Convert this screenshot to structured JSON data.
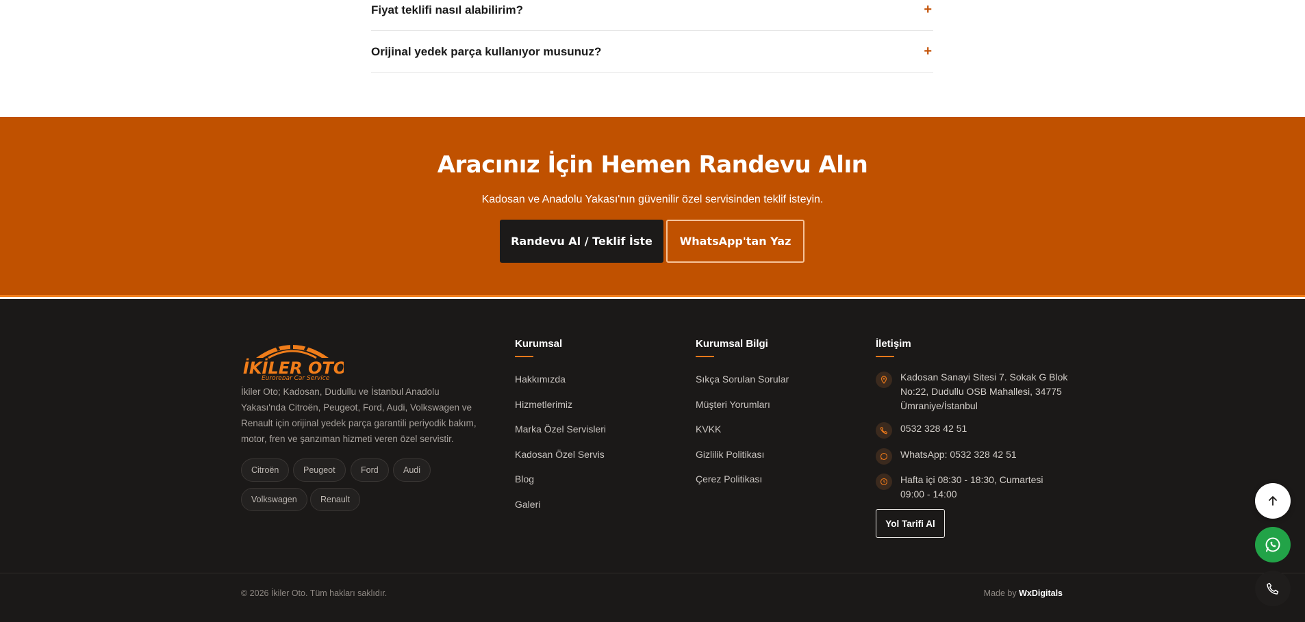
{
  "faq": {
    "items": [
      {
        "question": "Fiyat teklifi nasıl alabilirim?",
        "icon": "+"
      },
      {
        "question": "Orijinal yedek parça kullanıyor musunuz?",
        "icon": "+"
      }
    ]
  },
  "cta": {
    "title": "Aracınız İçin Hemen Randevu Alın",
    "subtitle": "Kadosan ve Anadolu Yakası'nın güvenilir özel servisinden teklif isteyin.",
    "primary_button": "Randevu Al / Teklif İste",
    "secondary_button": "WhatsApp'tan Yaz",
    "background_color": "#c05100"
  },
  "footer": {
    "logo": {
      "name": "İKİLER OTO",
      "tagline": "Eurorepar Car Service"
    },
    "about": "İkiler Oto; Kadosan, Dudullu ve İstanbul Anadolu Yakası'nda Citroën, Peugeot, Ford, Audi, Volkswagen ve Renault için orijinal yedek parça garantili periyodik bakım, motor, fren ve şanzıman hizmeti veren özel servistir.",
    "brands": [
      "Citroën",
      "Peugeot",
      "Ford",
      "Audi",
      "Volkswagen",
      "Renault"
    ],
    "columns": [
      {
        "title": "Kurumsal",
        "links": [
          "Hakkımızda",
          "Hizmetlerimiz",
          "Marka Özel Servisleri",
          "Kadosan Özel Servis",
          "Blog",
          "Galeri"
        ]
      },
      {
        "title": "Kurumsal Bilgi",
        "links": [
          "Sıkça Sorulan Sorular",
          "Müşteri Yorumları",
          "KVKK",
          "Gizlilik Politikası",
          "Çerez Politikası"
        ]
      }
    ],
    "contact": {
      "title": "İletişim",
      "address": "Kadosan Sanayi Sitesi 7. Sokak G Blok No:22, Dudullu OSB Mahallesi, 34775 Ümraniye/İstanbul",
      "phone": "0532 328 42 51",
      "whatsapp": "WhatsApp: 0532 328 42 51",
      "hours": "Hafta içi 08:30 - 18:30, Cumartesi 09:00 - 14:00",
      "directions_button": "Yol Tarifi Al"
    },
    "copyright": "© 2026 İkiler Oto. Tüm hakları saklıdır.",
    "made_by_prefix": "Made by",
    "made_by_brand": "WxDigitals"
  },
  "floating": {
    "icons": [
      "arrow-up-icon",
      "whatsapp-icon",
      "phone-icon"
    ],
    "whatsapp_color": "#22a348"
  },
  "colors": {
    "accent": "#e8771a",
    "footer_bg": "#1b1918"
  }
}
